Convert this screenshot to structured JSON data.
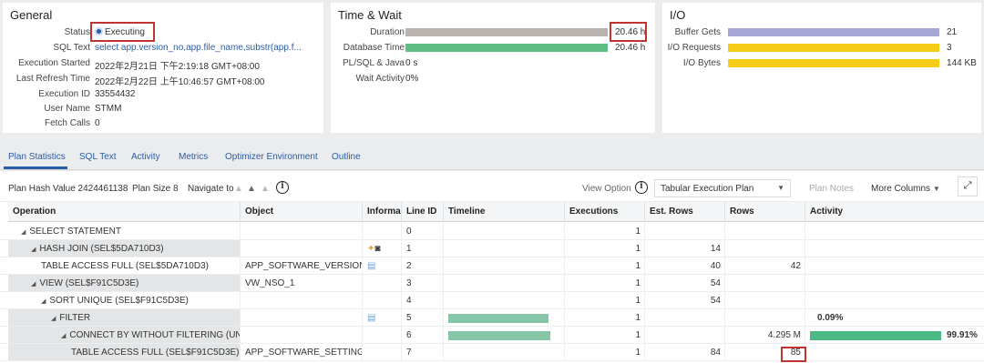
{
  "general": {
    "title": "General",
    "status_label": "Status",
    "status_value": "Executing",
    "fields": [
      {
        "label": "SQL Text",
        "value": "select app.version_no,app.file_name,substr(app.f..."
      },
      {
        "label": "Execution Started",
        "value": "2022年2月21日 下午2:19:18 GMT+08:00"
      },
      {
        "label": "Last Refresh Time",
        "value": "2022年2月22日 上午10:46:57 GMT+08:00"
      },
      {
        "label": "Execution ID",
        "value": "33554432"
      },
      {
        "label": "User Name",
        "value": "STMM"
      },
      {
        "label": "Fetch Calls",
        "value": "0"
      }
    ]
  },
  "time_wait": {
    "title": "Time & Wait",
    "rows": [
      {
        "label": "Duration",
        "value": "20.46 h",
        "bar_fraction": 1.0,
        "color": "#b9b2ae"
      },
      {
        "label": "Database Time",
        "value": "20.46 h",
        "bar_fraction": 1.0,
        "color": "#5fbe83"
      },
      {
        "label": "PL/SQL & Java",
        "value": "0 s",
        "bar_fraction": 0
      },
      {
        "label": "Wait Activity",
        "value": "0%",
        "bar_fraction": 0
      }
    ]
  },
  "io": {
    "title": "I/O",
    "rows": [
      {
        "label": "Buffer Gets",
        "value": "21",
        "color": "#a8a6d6"
      },
      {
        "label": "I/O Requests",
        "value": "3",
        "color": "#f5cc17"
      },
      {
        "label": "I/O Bytes",
        "value": "144 KB",
        "color": "#f5cc17"
      }
    ]
  },
  "tabs": [
    "Plan Statistics",
    "SQL Text",
    "Activity",
    "Metrics",
    "Optimizer Environment",
    "Outline"
  ],
  "toolbar": {
    "plan_hash": "Plan Hash Value 2424461138",
    "plan_size": "Plan Size 8",
    "navigate_to": "Navigate to",
    "view_option": "View Option",
    "view_select": "Tabular Execution Plan",
    "plan_notes": "Plan Notes",
    "more_columns": "More Columns"
  },
  "table": {
    "columns": [
      "Operation",
      "Object",
      "Informa",
      "Line ID",
      "Timeline",
      "Executions",
      "Est. Rows",
      "Rows",
      "Activity"
    ],
    "rows": [
      {
        "op": "SELECT STATEMENT",
        "indent": 0,
        "tri": true,
        "obj": "",
        "info": "",
        "line": "0",
        "exec": "1",
        "est": "",
        "rows": "",
        "act": "",
        "tl": 0,
        "act_frac": 0
      },
      {
        "op": "HASH JOIN (SEL$5DA710D3)",
        "indent": 1,
        "tri": true,
        "obj": "",
        "info": "keys-binoculars-icon",
        "line": "1",
        "exec": "1",
        "est": "14",
        "rows": "",
        "act": "",
        "tl": 0,
        "act_frac": 0
      },
      {
        "op": "TABLE ACCESS FULL (SEL$5DA710D3)",
        "indent": 2,
        "tri": false,
        "obj": "APP_SOFTWARE_VERSION",
        "info": "note-icon",
        "line": "2",
        "exec": "1",
        "est": "40",
        "rows": "42",
        "act": "",
        "tl": 0,
        "act_frac": 0
      },
      {
        "op": "VIEW (SEL$F91C5D3E)",
        "indent": 1,
        "tri": true,
        "obj": "VW_NSO_1",
        "info": "",
        "line": "3",
        "exec": "1",
        "est": "54",
        "rows": "",
        "act": "",
        "tl": 0,
        "act_frac": 0
      },
      {
        "op": "SORT UNIQUE (SEL$F91C5D3E)",
        "indent": 2,
        "tri": true,
        "obj": "",
        "info": "",
        "line": "4",
        "exec": "1",
        "est": "54",
        "rows": "",
        "act": "",
        "tl": 0,
        "act_frac": 0
      },
      {
        "op": "FILTER",
        "indent": 3,
        "tri": true,
        "obj": "",
        "info": "note-icon",
        "line": "5",
        "exec": "1",
        "est": "",
        "rows": "",
        "act": "0.09%",
        "tl": 1,
        "act_frac": 0
      },
      {
        "op": "CONNECT BY WITHOUT FILTERING (UNIQUE)",
        "indent": 4,
        "tri": true,
        "obj": "",
        "info": "",
        "line": "6",
        "exec": "1",
        "est": "",
        "rows": "4.295 M",
        "act": "99.91%",
        "tl": 1,
        "act_frac": 0.9991
      },
      {
        "op": "TABLE ACCESS FULL (SEL$F91C5D3E)",
        "indent": 5,
        "tri": false,
        "obj": "APP_SOFTWARE_SETTING",
        "info": "",
        "line": "7",
        "exec": "1",
        "est": "84",
        "rows": "85",
        "act": "",
        "tl": 0,
        "act_frac": 0
      }
    ]
  }
}
